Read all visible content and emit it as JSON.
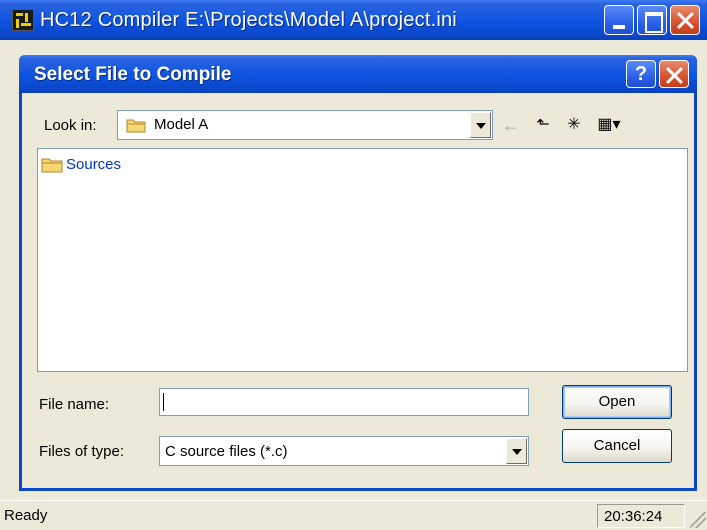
{
  "main_window": {
    "title": "HC12 Compiler  E:\\Projects\\Model A\\project.ini",
    "status_text": "Ready",
    "status_time": "20:36:24"
  },
  "dialog": {
    "title": "Select File to Compile",
    "help_label": "?",
    "look_in_label": "Look in:",
    "look_in_value": "Model A",
    "files": [
      {
        "name": "Sources",
        "icon": "folder-icon"
      }
    ],
    "file_name_label": "File name:",
    "file_name_value": "",
    "files_of_type_label": "Files of type:",
    "files_of_type_value": "C source files (*.c)",
    "open_label": "Open",
    "cancel_label": "Cancel"
  },
  "toolbar": {
    "back_icon": "←",
    "up_icon": "⬑",
    "new_folder_icon": "✳",
    "view_menu_icon": "▦▾"
  },
  "colors": {
    "titlebar": "#0a46c8",
    "link": "#0033cc",
    "face": "#ece9d8"
  }
}
